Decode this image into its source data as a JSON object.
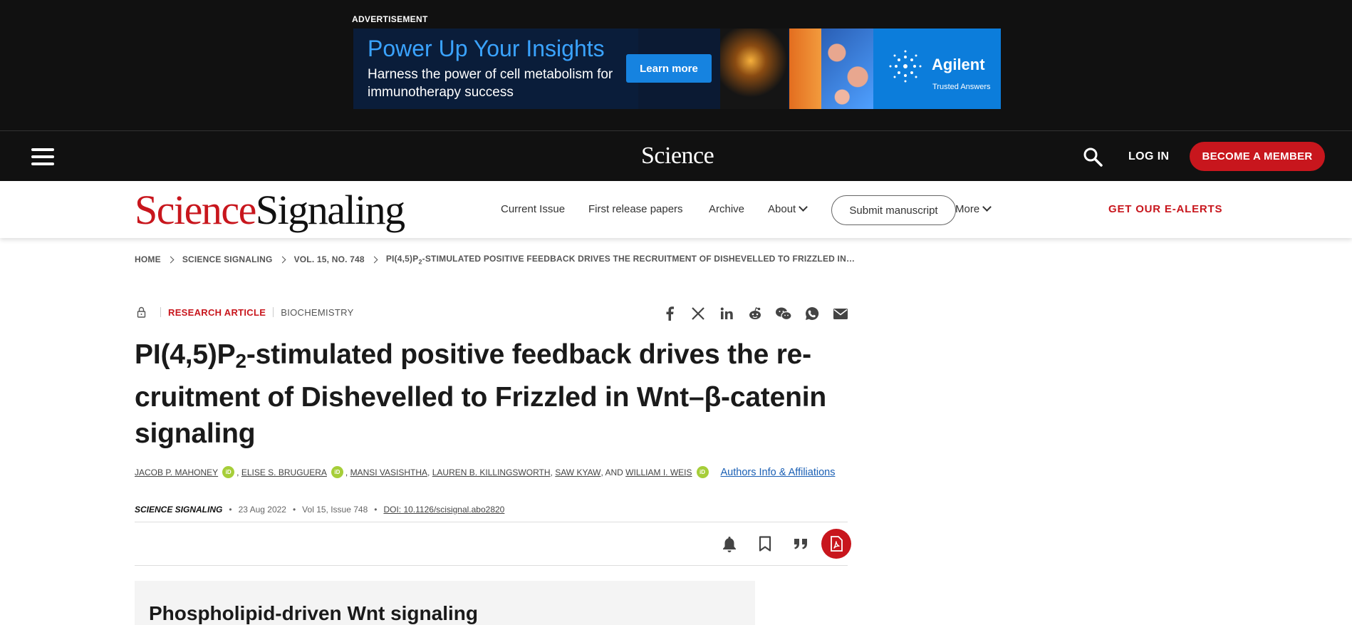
{
  "ad": {
    "label": "ADVERTISEMENT",
    "headline": "Power Up Your Insights",
    "subline": "Harness the power of cell metabolism for immunotherapy success",
    "cta": "Learn more",
    "brand": "Agilent",
    "tagline": "Trusted Answers"
  },
  "science_bar": {
    "logo": "Science",
    "login": "LOG IN",
    "member_cta": "BECOME A MEMBER"
  },
  "journal_nav": {
    "logo_red": "Science",
    "logo_black": "Signaling",
    "items": [
      "Current Issue",
      "First release papers",
      "Archive",
      "About"
    ],
    "submit": "Submit manuscript",
    "more": "More",
    "alerts": "GET OUR E-ALERTS"
  },
  "breadcrumb": [
    "HOME",
    "SCIENCE SIGNALING",
    "VOL. 15, NO. 748"
  ],
  "breadcrumb_current": {
    "pre": "PI(4,5)P",
    "sub": "2",
    "post": "-STIMULATED POSITIVE FEEDBACK DRIVES THE RECRUITMENT OF DISHEVELLED TO FRIZZLED IN…"
  },
  "article": {
    "type": "RESEARCH ARTICLE",
    "subject": "BIOCHEMISTRY",
    "title": {
      "pre": "PI(4,5)P",
      "sub": "2",
      "line1_rest": "-stimulated positive feedback drives the re-",
      "line2": "cruitment of Dishevelled to Frizzled in Wnt–β-catenin",
      "line3": "signaling"
    },
    "authors": [
      "JACOB P. MAHONEY",
      "ELISE S. BRUGUERA",
      "MANSI VASISHTHA",
      "LAUREN B. KILLINGSWORTH",
      "SAW KYAW",
      "WILLIAM I. WEIS"
    ],
    "orcid_label": "iD",
    "sep_comma": ",",
    "and_text": ", AND",
    "affiliations_link": "Authors Info & Affiliations",
    "journal": "SCIENCE SIGNALING",
    "date": "23 Aug 2022",
    "volume": "Vol 15, Issue 748",
    "doi": "DOI: 10.1126/scisignal.abo2820",
    "dot": "•",
    "summary_title": "Phospholipid-driven Wnt signaling"
  },
  "colors": {
    "brand_red": "#c8161d",
    "link_blue": "#1a5fb4",
    "orcid_green": "#a6ce39",
    "dark_bar": "#111111"
  },
  "icons": {
    "share": [
      "facebook-icon",
      "x-icon",
      "linkedin-icon",
      "reddit-icon",
      "wechat-icon",
      "whatsapp-icon",
      "email-icon"
    ],
    "tools": [
      "bell-icon",
      "bookmark-icon",
      "quote-icon",
      "pdf-icon"
    ]
  }
}
